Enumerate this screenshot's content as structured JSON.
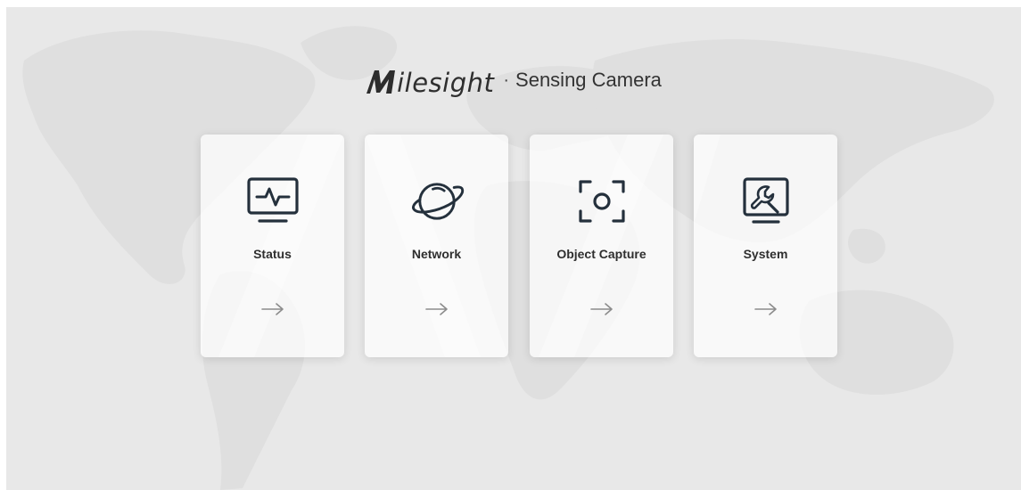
{
  "header": {
    "brand_mark": "M",
    "brand_name": "ilesight",
    "separator": "·",
    "product_name": "Sensing Camera"
  },
  "cards": [
    {
      "label": "Status",
      "icon": "monitor-pulse-icon",
      "arrow_icon": "arrow-right-icon"
    },
    {
      "label": "Network",
      "icon": "planet-icon",
      "arrow_icon": "arrow-right-icon"
    },
    {
      "label": "Object Capture",
      "icon": "focus-frame-icon",
      "arrow_icon": "arrow-right-icon"
    },
    {
      "label": "System",
      "icon": "monitor-wrench-icon",
      "arrow_icon": "arrow-right-icon"
    }
  ],
  "colors": {
    "background": "#e8e8e8",
    "card": "#f7f7f7",
    "icon": "#24303c",
    "text": "#2f2f2f",
    "arrow": "#8c8c8c"
  }
}
